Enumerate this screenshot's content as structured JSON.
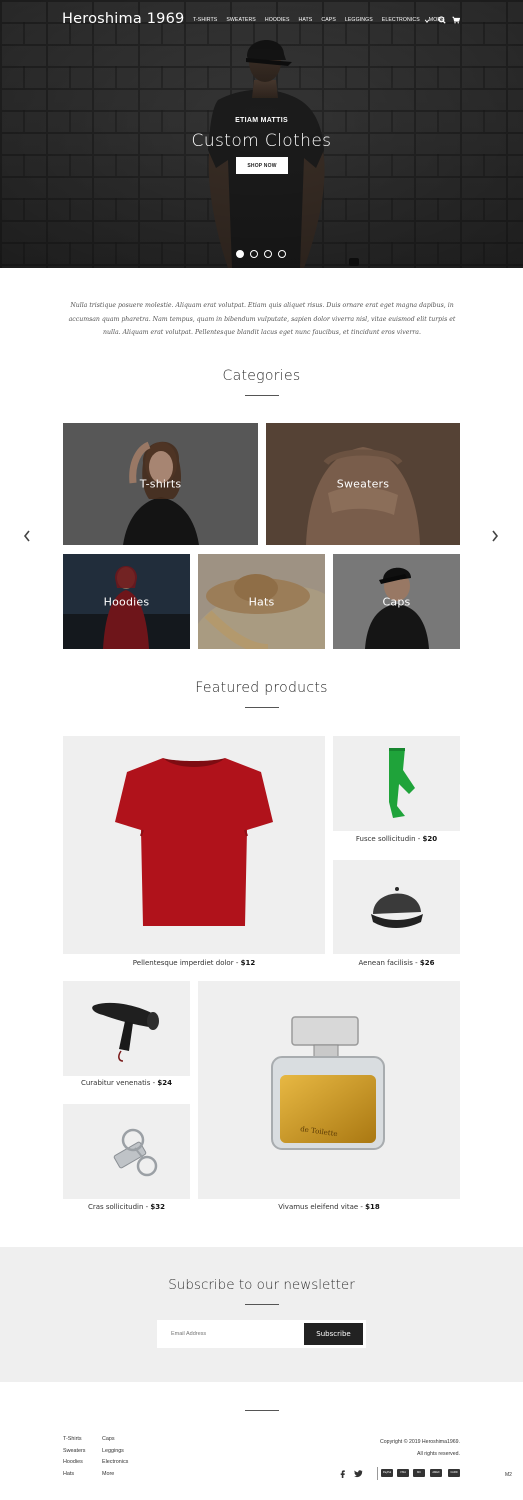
{
  "header": {
    "logo": "Heroshima 1969",
    "nav": [
      "T-SHIRTS",
      "SWEATERS",
      "HOODIES",
      "HATS",
      "CAPS",
      "LEGGINGS",
      "ELECTRONICS"
    ],
    "more_label": "MORE",
    "icons": [
      "chevron-down-icon",
      "search-icon",
      "cart-icon"
    ]
  },
  "hero": {
    "subtitle": "ETIAM MATTIS",
    "title": "Custom Clothes",
    "button": "SHOP NOW",
    "slides": 4,
    "active_slide": 1
  },
  "intro": "Nulla tristique posuere molestie. Aliquam erat volutpat. Etiam quis aliquet risus. Duis ornare erat eget magna dapibus, in accumsan quam pharetra. Nam tempus, quam in bibendum vulputate, sapien dolor viverra nisl, vitae euismod elit turpis et nulla. Aliquam erat volutpat. Pellentesque blandit lacus eget nunc faucibus, et tincidunt eros viverra.",
  "categories": {
    "title": "Categories",
    "items": [
      "T-shirts",
      "Sweaters",
      "Hoodies",
      "Hats",
      "Caps"
    ],
    "icons": [
      "chevron-left-icon",
      "chevron-right-icon"
    ]
  },
  "featured": {
    "title": "Featured products",
    "products": [
      {
        "name": "Pellentesque imperdiet dolor",
        "price": "$12"
      },
      {
        "name": "Fusce sollicitudin",
        "price": "$20"
      },
      {
        "name": "Aenean facilisis",
        "price": "$26"
      },
      {
        "name": "Curabitur venenatis",
        "price": "$24"
      },
      {
        "name": "Cras sollicitudin",
        "price": "$32"
      },
      {
        "name": "Vivamus eleifend vitae",
        "price": "$18"
      }
    ]
  },
  "newsletter": {
    "title": "Subscribe to our newsletter",
    "placeholder": "Email Address",
    "button": "Subscribe"
  },
  "footer": {
    "col1": [
      "T-Shirts",
      "Sweaters",
      "Hoodies",
      "Hats"
    ],
    "col2": [
      "Caps",
      "Leggings",
      "Electronics",
      "More"
    ],
    "copyright": "Copyright © 2019 Heroshima1969.",
    "rights": "All rights reserved.",
    "social": [
      "facebook-icon",
      "twitter-icon"
    ],
    "payments": [
      "PayPal",
      "VISA",
      "MC",
      "AMEX",
      "CARD"
    ],
    "badge": "M2"
  },
  "colors": {
    "accent_dark": "#222222",
    "panel_gray": "#efefef",
    "tshirt_red": "#b0121b",
    "legging_green": "#1fa33a"
  }
}
